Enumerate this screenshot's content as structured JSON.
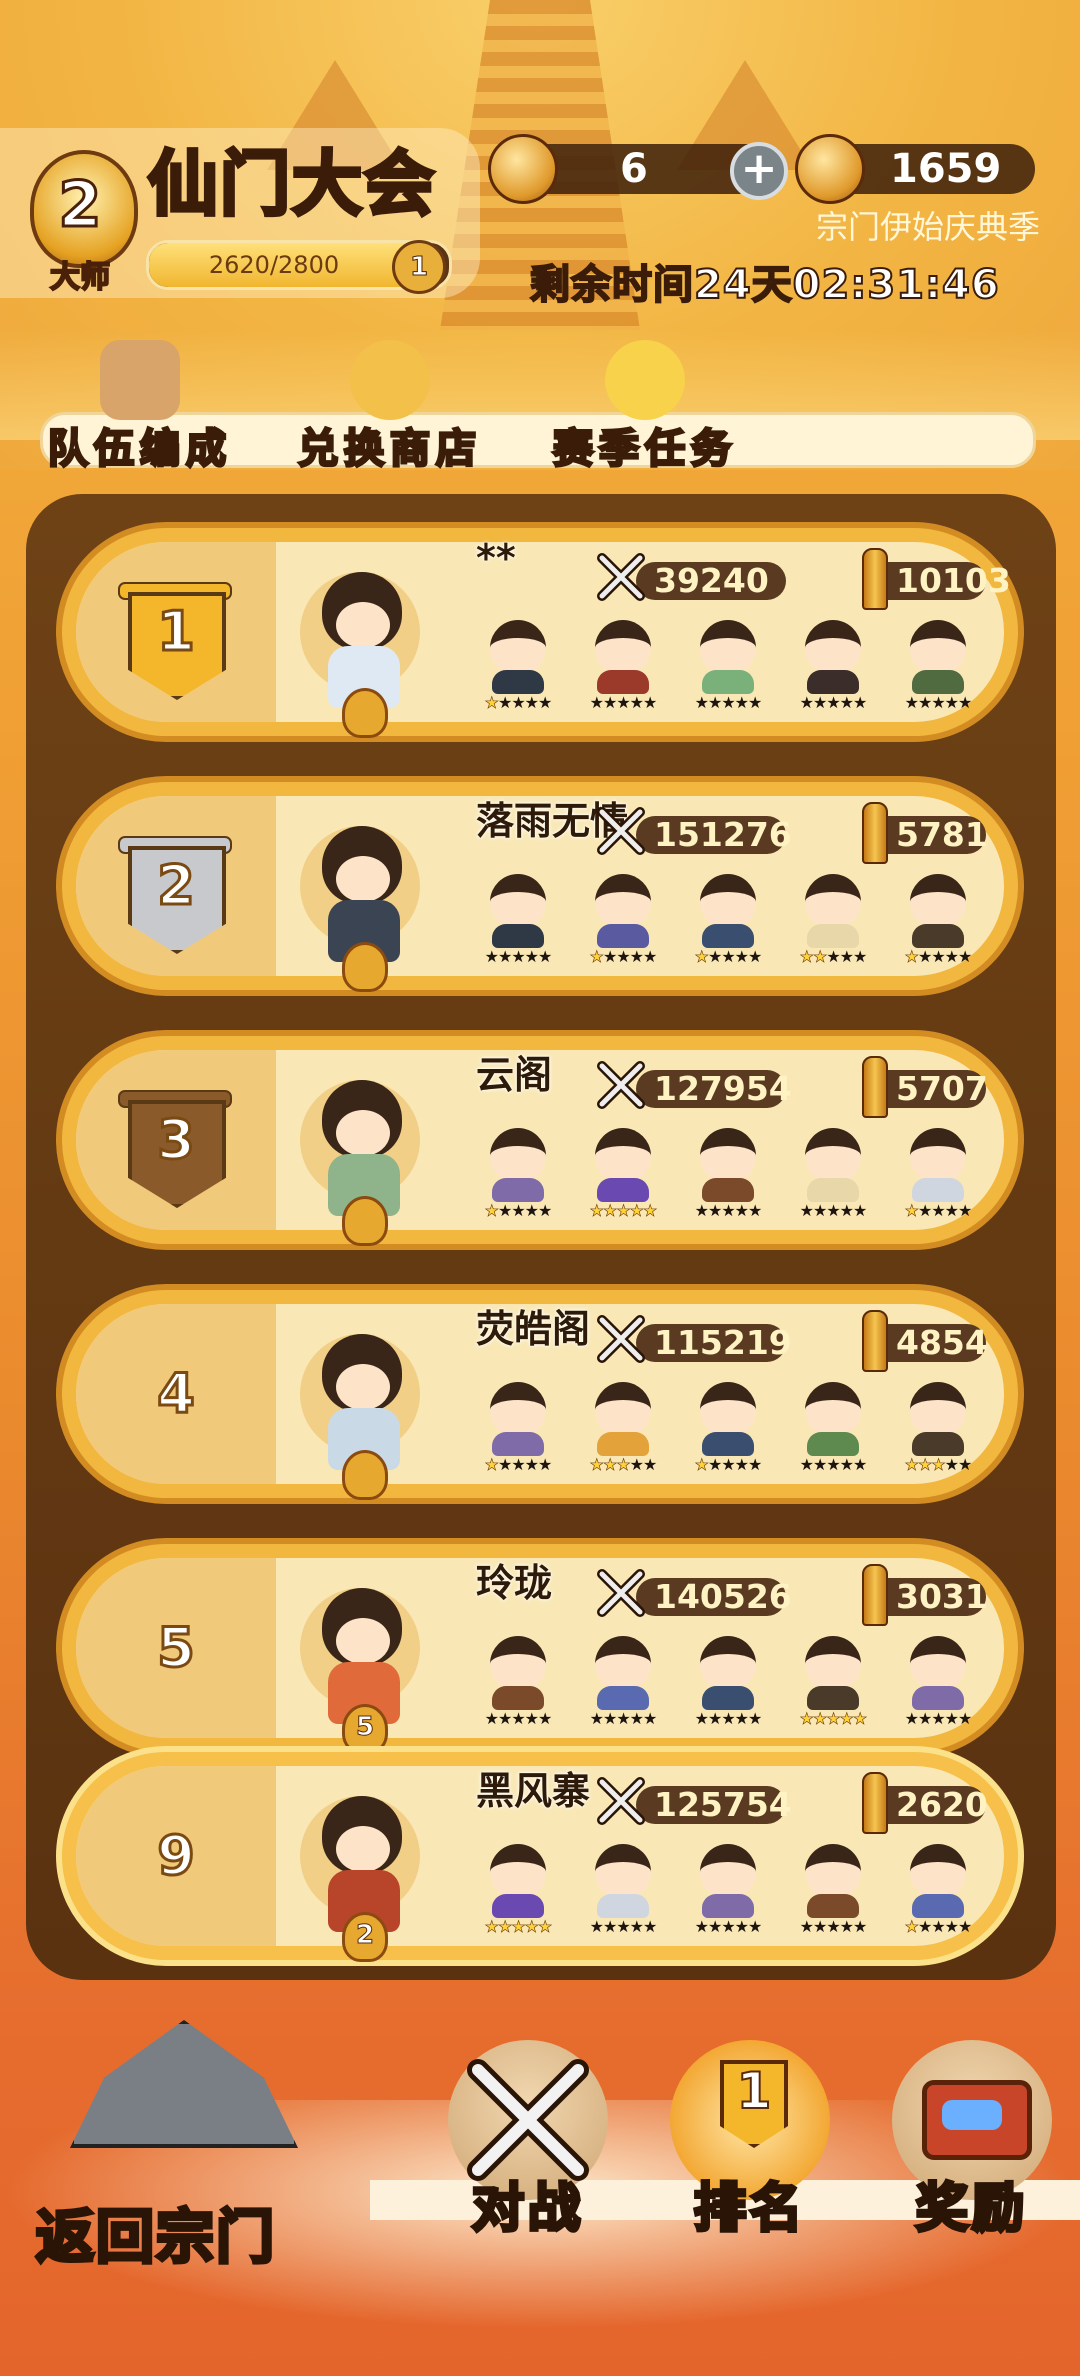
{
  "header": {
    "rank_level": "2",
    "rank_title": "大师",
    "title": "仙门大会",
    "xp_text": "2620/2800",
    "xp_progress": 0.936,
    "xp_badge": "1",
    "currency_tokens": "6",
    "currency_coins": "1659",
    "season_name": "宗门伊始庆典季",
    "timer": "剩余时间24天02:31:46"
  },
  "menu": {
    "team": "队伍编成",
    "shop": "兑换商店",
    "tasks": "赛季任务"
  },
  "rankings": [
    {
      "rank": "1",
      "name": "**",
      "power": "39240",
      "score": "10103",
      "flag": "gold",
      "leader_color": "#dfe9f3",
      "heroes": [
        {
          "body": "#2f3845",
          "stars": 1
        },
        {
          "body": "#9b3a2a",
          "stars": 0
        },
        {
          "body": "#7ab07a",
          "stars": 0
        },
        {
          "body": "#3a2d2a",
          "stars": 0
        },
        {
          "body": "#4f6b3f",
          "stars": 0
        }
      ]
    },
    {
      "rank": "2",
      "name": "落雨无情",
      "power": "151276",
      "score": "5781",
      "flag": "silver",
      "leader_color": "#3a4453",
      "heroes": [
        {
          "body": "#2f3845",
          "stars": 0
        },
        {
          "body": "#5a5aa0",
          "stars": 1
        },
        {
          "body": "#3a4e70",
          "stars": 1
        },
        {
          "body": "#e8d7a8",
          "stars": 2
        },
        {
          "body": "#4a3a2a",
          "stars": 1
        }
      ]
    },
    {
      "rank": "3",
      "name": "云阁",
      "power": "127954",
      "score": "5707",
      "flag": "bronze",
      "leader_color": "#8fb38a",
      "heroes": [
        {
          "body": "#7e6ba8",
          "stars": 1
        },
        {
          "body": "#6a4ab0",
          "stars": 5
        },
        {
          "body": "#7a4a2a",
          "stars": 0
        },
        {
          "body": "#e8d7a8",
          "stars": 0
        },
        {
          "body": "#d0d6e0",
          "stars": 1
        }
      ]
    },
    {
      "rank": "4",
      "name": "荧皓阁",
      "power": "115219",
      "score": "4854",
      "flag": "none",
      "leader_color": "#c9d9e6",
      "heroes": [
        {
          "body": "#7e6ba8",
          "stars": 1
        },
        {
          "body": "#e4a23a",
          "stars": 3
        },
        {
          "body": "#3a4e70",
          "stars": 1
        },
        {
          "body": "#5f8a4f",
          "stars": 0
        },
        {
          "body": "#4a3a2a",
          "stars": 3
        }
      ]
    },
    {
      "rank": "5",
      "name": "玲珑",
      "power": "140526",
      "score": "3031",
      "flag": "none",
      "leader_color": "#e06a3a",
      "badge": "5",
      "heroes": [
        {
          "body": "#7a4a2a",
          "stars": 0
        },
        {
          "body": "#5a6ab0",
          "stars": 0
        },
        {
          "body": "#3a4e70",
          "stars": 0
        },
        {
          "body": "#4a3a2a",
          "stars": 5
        },
        {
          "body": "#7e6ba8",
          "stars": 0
        }
      ]
    },
    {
      "rank": "9",
      "name": "黑风寨",
      "power": "125754",
      "score": "2620",
      "flag": "none",
      "leader_color": "#b8442a",
      "badge": "2",
      "me": true,
      "heroes": [
        {
          "body": "#6a4ab0",
          "stars": 5
        },
        {
          "body": "#d0d6e0",
          "stars": 0
        },
        {
          "body": "#7e6ba8",
          "stars": 0
        },
        {
          "body": "#7a4a2a",
          "stars": 0
        },
        {
          "body": "#5a6ab0",
          "stars": 1
        }
      ]
    }
  ],
  "nav": {
    "home": "返回宗门",
    "battle": "对战",
    "ranking": "排名",
    "rewards": "奖励",
    "ranking_badge": "1"
  },
  "colors": {
    "flag_gold": "#f4b62a",
    "flag_silver": "#c7c9cc",
    "flag_bronze": "#8a5a2a"
  },
  "icons": [
    "sword-icon",
    "pillar-icon",
    "token-icon",
    "coin-icon",
    "plus-icon",
    "team-icon",
    "shop-icon",
    "tasks-icon",
    "home-icon",
    "battle-icon",
    "ranking-icon",
    "chest-icon"
  ]
}
